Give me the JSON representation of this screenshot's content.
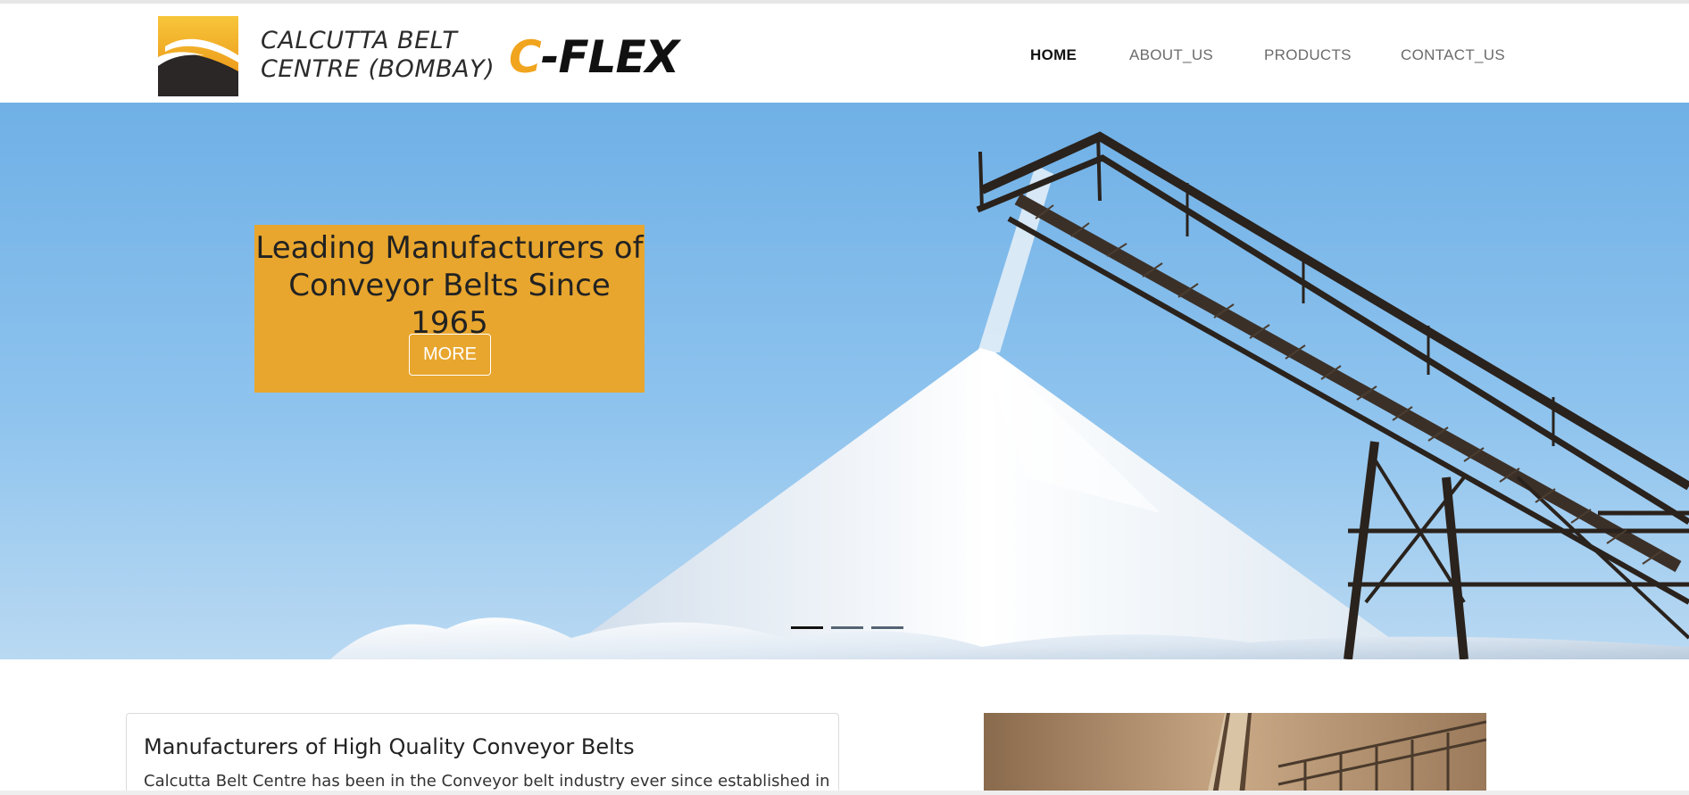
{
  "header": {
    "brand_line1": "CALCUTTA BELT",
    "brand_line2": "CENTRE (BOMBAY)",
    "product_logo_c": "C",
    "product_logo_rest": "-FLEX",
    "nav": [
      {
        "label": "HOME",
        "active": true
      },
      {
        "label": "ABOUT_US",
        "active": false
      },
      {
        "label": "PRODUCTS",
        "active": false
      },
      {
        "label": "CONTACT_US",
        "active": false
      }
    ]
  },
  "hero": {
    "caption_line1": "Leading Manufacturers of",
    "caption_line2": "Conveyor Belts Since 1965",
    "more_label": "MORE",
    "slides": 3,
    "active_slide": 0,
    "caption_bg": "#e8a62e"
  },
  "intro": {
    "title": "Manufacturers of High Quality Conveyor Belts",
    "text": "Calcutta Belt Centre has been in the Conveyor belt industry ever since established in"
  },
  "colors": {
    "accent": "#f1a41d",
    "nav_active": "#111111",
    "nav_inactive": "#6b6b6b"
  },
  "icons": {
    "logo": "swoosh-logo-icon"
  }
}
